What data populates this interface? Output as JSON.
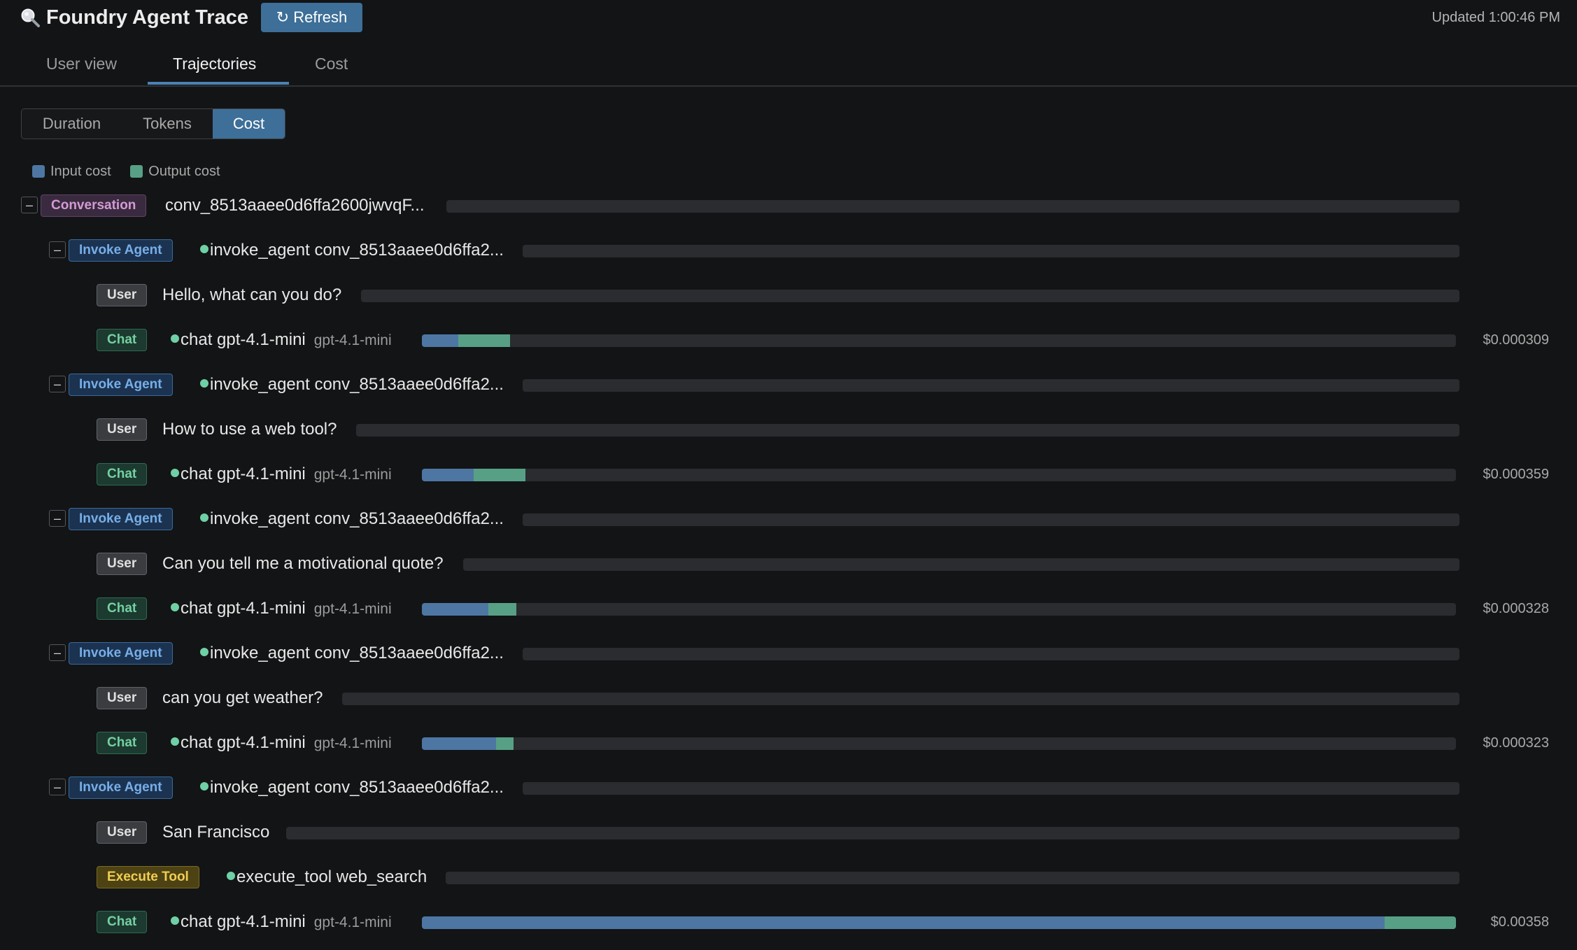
{
  "header": {
    "title": "Foundry Agent Trace",
    "refresh_label": "↻ Refresh",
    "updated": "Updated 1:00:46 PM"
  },
  "tabs": [
    {
      "label": "User view",
      "active": false
    },
    {
      "label": "Trajectories",
      "active": true
    },
    {
      "label": "Cost",
      "active": false
    }
  ],
  "metric_toggle": [
    {
      "label": "Duration",
      "active": false
    },
    {
      "label": "Tokens",
      "active": false
    },
    {
      "label": "Cost",
      "active": true
    }
  ],
  "legend": {
    "input_label": "Input cost",
    "output_label": "Output cost"
  },
  "colors": {
    "input": "#4e76a3",
    "output": "#57a086",
    "accent": "#3d6f98"
  },
  "rows": [
    {
      "kind": "conv",
      "badge": "Conversation",
      "label": "conv_8513aaee0d6ffa2600jwvqF...",
      "toggle": "–"
    },
    {
      "kind": "agent",
      "badge": "Invoke Agent",
      "label": "invoke_agent conv_8513aaee0d6ffa2...",
      "toggle": "–"
    },
    {
      "kind": "user",
      "badge": "User",
      "label": "Hello, what can you do?"
    },
    {
      "kind": "chat",
      "badge": "Chat",
      "label": "chat gpt-4.1-mini",
      "model": "gpt-4.1-mini",
      "input_share": 0.0355,
      "output_share": 0.05,
      "cost": "$0.000309"
    },
    {
      "kind": "agent",
      "badge": "Invoke Agent",
      "label": "invoke_agent conv_8513aaee0d6ffa2...",
      "toggle": "–"
    },
    {
      "kind": "user",
      "badge": "User",
      "label": "How to use a web tool?"
    },
    {
      "kind": "chat",
      "badge": "Chat",
      "label": "chat gpt-4.1-mini",
      "model": "gpt-4.1-mini",
      "input_share": 0.05,
      "output_share": 0.05,
      "cost": "$0.000359"
    },
    {
      "kind": "agent",
      "badge": "Invoke Agent",
      "label": "invoke_agent conv_8513aaee0d6ffa2...",
      "toggle": "–"
    },
    {
      "kind": "user",
      "badge": "User",
      "label": "Can you tell me a motivational quote?"
    },
    {
      "kind": "chat",
      "badge": "Chat",
      "label": "chat gpt-4.1-mini",
      "model": "gpt-4.1-mini",
      "input_share": 0.064,
      "output_share": 0.027,
      "cost": "$0.000328"
    },
    {
      "kind": "agent",
      "badge": "Invoke Agent",
      "label": "invoke_agent conv_8513aaee0d6ffa2...",
      "toggle": "–"
    },
    {
      "kind": "user",
      "badge": "User",
      "label": "can you get weather?"
    },
    {
      "kind": "chat",
      "badge": "Chat",
      "label": "chat gpt-4.1-mini",
      "model": "gpt-4.1-mini",
      "input_share": 0.072,
      "output_share": 0.017,
      "cost": "$0.000323"
    },
    {
      "kind": "agent",
      "badge": "Invoke Agent",
      "label": "invoke_agent conv_8513aaee0d6ffa2...",
      "toggle": "–"
    },
    {
      "kind": "user",
      "badge": "User",
      "label": "San Francisco"
    },
    {
      "kind": "tool",
      "badge": "Execute Tool",
      "label": "execute_tool web_search"
    },
    {
      "kind": "chat",
      "badge": "Chat",
      "label": "chat gpt-4.1-mini",
      "model": "gpt-4.1-mini",
      "input_share": 0.931,
      "output_share": 0.069,
      "cost": "$0.00358"
    }
  ]
}
